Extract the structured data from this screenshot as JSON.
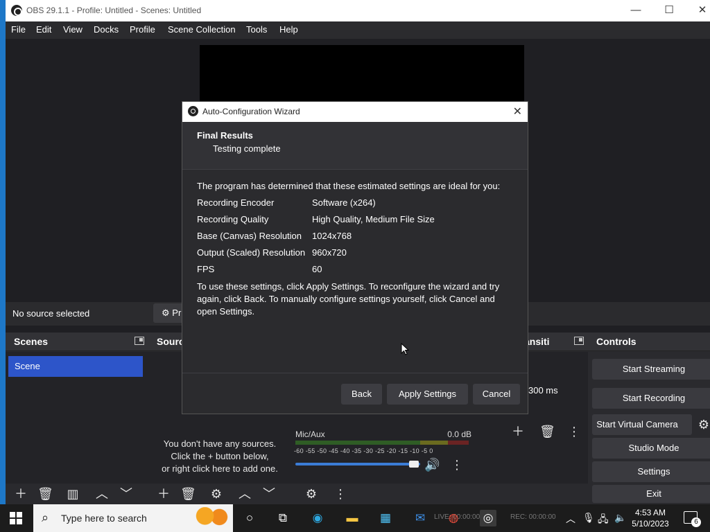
{
  "window": {
    "title": "OBS 29.1.1 - Profile: Untitled - Scenes: Untitled",
    "min_icon": "minimize-icon",
    "max_icon": "maximize-icon",
    "close_icon": "close-icon"
  },
  "menu": [
    "File",
    "Edit",
    "View",
    "Docks",
    "Profile",
    "Scene Collection",
    "Tools",
    "Help"
  ],
  "source_bar": {
    "status": "No source selected",
    "properties_label": "Pr"
  },
  "docks": {
    "scenes": {
      "title": "Scenes",
      "items": [
        "Scene"
      ]
    },
    "sources": {
      "title": "Sourc",
      "empty_line1": "You don't have any sources.",
      "empty_line2": "Click the + button below,",
      "empty_line3": "or right click here to add one."
    },
    "mixer": {
      "channel": "Mic/Aux",
      "db": "0.0 dB",
      "ticks": "-60 -55 -50 -45 -40 -35 -30 -25 -20 -15 -10 -5 0",
      "volume": 0.95
    },
    "transitions": {
      "title": "ansiti",
      "duration": "300 ms"
    },
    "controls": {
      "title": "Controls",
      "buttons": [
        "Start Streaming",
        "Start Recording",
        "Start Virtual Camera",
        "Studio Mode",
        "Settings",
        "Exit"
      ]
    }
  },
  "dialog": {
    "title": "Auto-Configuration Wizard",
    "heading": "Final Results",
    "subheading": "Testing complete",
    "intro": "The program has determined that these estimated settings are ideal for you:",
    "rows": [
      {
        "label": "Recording Encoder",
        "value": "Software (x264)"
      },
      {
        "label": "Recording Quality",
        "value": "High Quality, Medium File Size"
      },
      {
        "label": "Base (Canvas) Resolution",
        "value": "1024x768"
      },
      {
        "label": "Output (Scaled) Resolution",
        "value": "960x720"
      },
      {
        "label": "FPS",
        "value": "60"
      }
    ],
    "note": "To use these settings, click Apply Settings. To reconfigure the wizard and try again, click Back. To manually configure settings yourself, click Cancel and open Settings.",
    "buttons": {
      "back": "Back",
      "apply": "Apply Settings",
      "cancel": "Cancel"
    }
  },
  "taskbar": {
    "search_placeholder": "Type here to search",
    "status_live": "LIVE: 00:00:00",
    "status_rec": "REC: 00:00:00",
    "time": "4:53 AM",
    "date": "5/10/2023",
    "notifications": "6"
  },
  "colors": {
    "accent": "#2d55c9",
    "dialog_bg": "#2b2b2e",
    "window_bg": "#1f1f23"
  }
}
